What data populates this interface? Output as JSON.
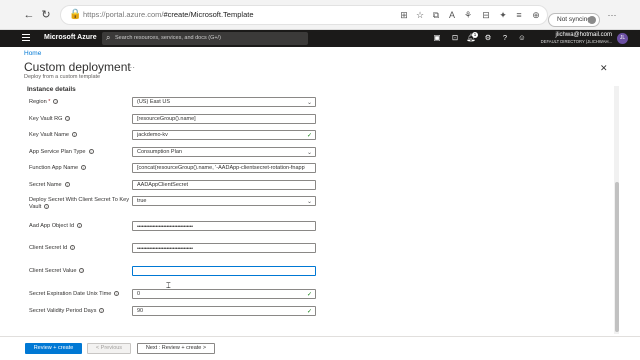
{
  "browser": {
    "url_host": "https://portal.azure.com/",
    "url_path": "#create/Microsoft.Template",
    "profile_label": "Not syncing"
  },
  "azure": {
    "brand": "Microsoft Azure",
    "search_placeholder": "Search resources, services, and docs (G+/)",
    "notification_count": "1",
    "user_email": "jlichwa@hotmail.com",
    "user_directory": "DEFAULT DIRECTORY (JLICHWAH...",
    "avatar_initials": "JL"
  },
  "page": {
    "breadcrumb": "Home",
    "title": "Custom deployment",
    "more": "···",
    "subtitle": "Deploy from a custom template",
    "close": "✕",
    "section": "Instance details"
  },
  "fields": [
    {
      "label": "Region",
      "required": "*",
      "value": "(US) East US",
      "type": "dropdown"
    },
    {
      "label": "Key Vault RG",
      "value": "[resourceGroup().name]",
      "type": "text"
    },
    {
      "label": "Key Vault Name",
      "value": "jackdemo-kv",
      "type": "text"
    },
    {
      "label": "App Service Plan Type",
      "value": "Consumption Plan",
      "type": "dropdown"
    },
    {
      "label": "Function App Name",
      "value": "[concat(resourceGroup().name, '-AADApp-clientsecret-rotation-fnapp')]",
      "type": "text"
    },
    {
      "label": "Secret Name",
      "value": "AADAppClientSecret",
      "type": "text"
    },
    {
      "label": "Deploy Secret With Client Secret To Key Vault",
      "value": "true",
      "type": "dropdown"
    },
    {
      "label": "Aad App Object Id",
      "value": "••••••••••••••••••••••••••••••••••••",
      "type": "password"
    },
    {
      "label": "Client Secret Id",
      "value": "••••••••••••••••••••••••••••••••••••",
      "type": "password"
    },
    {
      "label": "Client Secret Value",
      "value": "",
      "type": "text"
    },
    {
      "label": "Secret Expiration Date Unix Time",
      "value": "0",
      "type": "text"
    },
    {
      "label": "Secret Validity Period Days",
      "value": "90",
      "type": "text"
    }
  ],
  "footer": {
    "review_create": "Review + create",
    "previous": "< Previous",
    "next": "Next : Review + create >"
  },
  "colors": {
    "accent": "#0078d4",
    "topbar": "#1b1a19"
  }
}
